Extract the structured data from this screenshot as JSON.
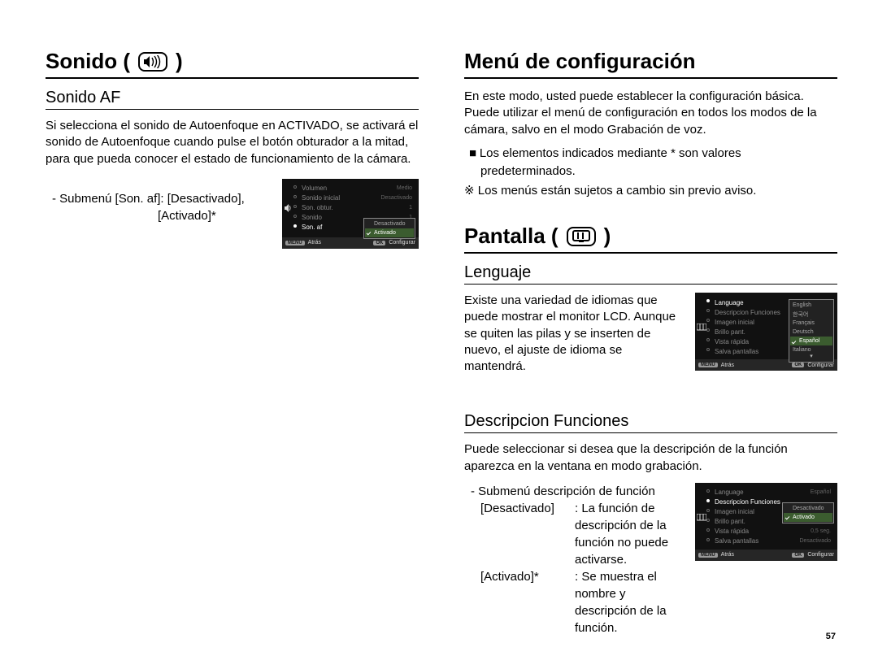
{
  "page_number": "57",
  "left": {
    "title": "Sonido (",
    "title_close": ")",
    "icon": "speaker-icon",
    "subsection": "Sonido AF",
    "paragraph": "Si selecciona el sonido de Autoenfoque en ACTIVADO, se activará el sonido de Autoenfoque cuando pulse el botón obturador a la mitad, para que pueda conocer el estado de funcionamiento de la cámara.",
    "submenu_line1": "- Submenú [Son. af]: [Desactivado],",
    "submenu_line2": "[Activado]*",
    "lcd": {
      "items": [
        {
          "label": "Volumen",
          "val": "Medio"
        },
        {
          "label": "Sonido inicial",
          "val": "Desactivado"
        },
        {
          "label": "Son. obtur.",
          "val": "1"
        },
        {
          "label": "Sonido",
          "val": "1"
        },
        {
          "label": "Son. af",
          "val": "",
          "hl": true
        }
      ],
      "popup": [
        {
          "label": "Desactivado",
          "sel": false
        },
        {
          "label": "Activado",
          "sel": true
        }
      ],
      "footer": {
        "left_btn": "MENU",
        "left_lbl": "Atrás",
        "right_btn": "OK",
        "right_lbl": "Configurar"
      }
    }
  },
  "right": {
    "title1": "Menú de configuración",
    "p1": "En este modo, usted puede establecer la configuración básica. Puede utilizar el menú de configuración en todos los modos de la cámara, salvo en el modo Grabación de voz.",
    "bullet1": "Los elementos indicados mediante * son valores predeterminados.",
    "note": "※ Los menús están sujetos a cambio sin previo aviso.",
    "title2": "Pantalla (",
    "title2_close": ")",
    "icon2": "display-icon",
    "lang": {
      "heading": "Lenguaje",
      "paragraph": "Existe una variedad de idiomas que puede mostrar el monitor LCD. Aunque se quiten las pilas y se inserten de nuevo, el ajuste de idioma se mantendrá.",
      "lcd": {
        "items": [
          {
            "label": "Language",
            "val": "",
            "hl": true
          },
          {
            "label": "Descripcion Funciones",
            "val": ""
          },
          {
            "label": "Imagen inicial",
            "val": ""
          },
          {
            "label": "Brillo pant.",
            "val": ""
          },
          {
            "label": "Vista rápida",
            "val": ""
          },
          {
            "label": "Salva pantallas",
            "val": ""
          }
        ],
        "popup": [
          {
            "label": "English",
            "sel": false
          },
          {
            "label": "한국어",
            "sel": false
          },
          {
            "label": "Français",
            "sel": false
          },
          {
            "label": "Deutsch",
            "sel": false
          },
          {
            "label": "Español",
            "sel": true
          },
          {
            "label": "Italiano",
            "sel": false
          }
        ],
        "footer": {
          "left_btn": "MENU",
          "left_lbl": "Atrás",
          "right_btn": "OK",
          "right_lbl": "Configurar"
        }
      }
    },
    "desc": {
      "heading": "Descripcion Funciones",
      "paragraph": "Puede seleccionar si desea que la descripción de la función aparezca en la ventana en modo grabación.",
      "sub_intro": "- Submenú descripción de función",
      "rows": [
        {
          "k": "[Desactivado]",
          "v": ": La función de descripción de la función no puede activarse."
        },
        {
          "k": "[Activado]*",
          "v": ": Se muestra el nombre y descripción de la función."
        }
      ],
      "lcd": {
        "items": [
          {
            "label": "Language",
            "val": "Español"
          },
          {
            "label": "Descripcion Funciones",
            "val": "",
            "hl": true
          },
          {
            "label": "Imagen inicial",
            "val": ""
          },
          {
            "label": "Brillo pant.",
            "val": ""
          },
          {
            "label": "Vista rápida",
            "val": "0,5 seg."
          },
          {
            "label": "Salva pantallas",
            "val": "Desactivado"
          }
        ],
        "popup": [
          {
            "label": "Desactivado",
            "sel": false
          },
          {
            "label": "Activado",
            "sel": true
          }
        ],
        "footer": {
          "left_btn": "MENU",
          "left_lbl": "Atrás",
          "right_btn": "OK",
          "right_lbl": "Configurar"
        }
      }
    }
  }
}
